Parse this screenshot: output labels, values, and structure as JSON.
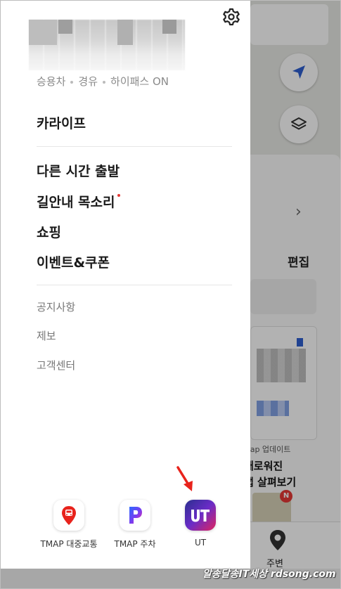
{
  "drawer": {
    "car_info": [
      "승용차",
      "경유",
      "하이패스 ON"
    ],
    "menu_primary": [
      "카라이프"
    ],
    "menu_secondary": [
      "다른 시간 출발",
      "길안내 목소리",
      "쇼핑",
      "이벤트&쿠폰"
    ],
    "menu_tertiary": [
      "공지사항",
      "제보",
      "고객센터"
    ],
    "shortcuts": [
      {
        "label": "TMAP 대중교통",
        "icon": "bus-stop-pin-icon"
      },
      {
        "label": "TMAP 주차",
        "icon": "parking-p-icon"
      },
      {
        "label": "UT",
        "icon": "ut-logo-icon"
      }
    ],
    "settings_icon": "gear-icon",
    "new_badge_color": "#e53935"
  },
  "background": {
    "edit_label": "편집",
    "update_label": "map 업데이트",
    "news_line1": "새로워진",
    "news_line2": "앱 살펴보기",
    "new_badge": "N",
    "nearby_label": "주변",
    "accent": "#2f5fd0"
  },
  "watermark": "알송달송IT세상 rdsong.com"
}
